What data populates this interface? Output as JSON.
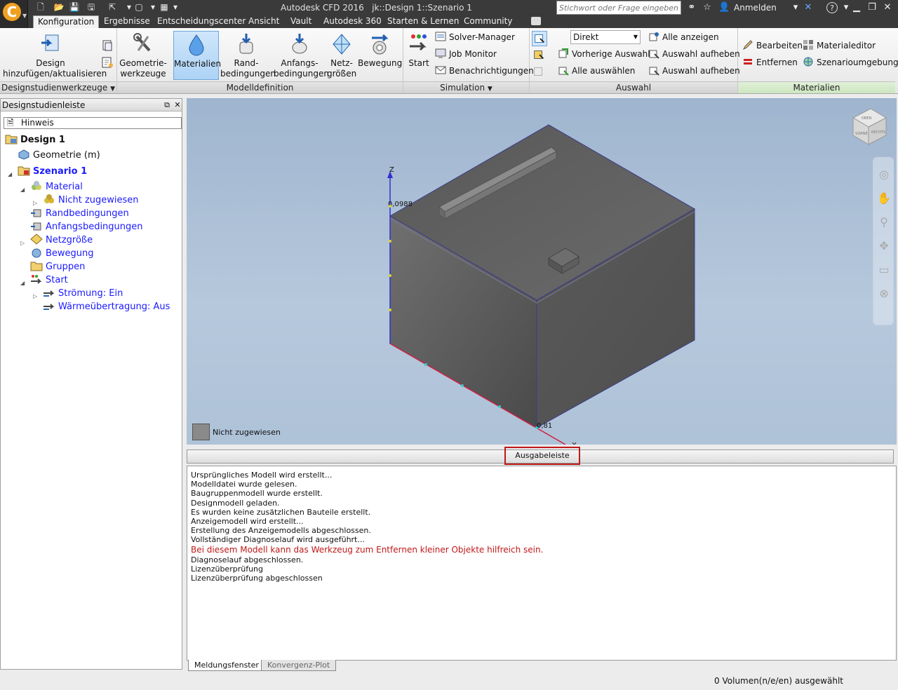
{
  "titlebar": {
    "app_name": "Autodesk CFD 2016",
    "document": "jk::Design 1::Szenario 1",
    "search_placeholder": "Stichwort oder Frage eingeben",
    "signin_label": "Anmelden",
    "help_label": "?"
  },
  "tabs": [
    {
      "label": "Konfiguration"
    },
    {
      "label": "Ergebnisse"
    },
    {
      "label": "Entscheidungscenter"
    },
    {
      "label": "Ansicht"
    },
    {
      "label": "Vault"
    },
    {
      "label": "Autodesk 360"
    },
    {
      "label": "Starten & Lernen"
    },
    {
      "label": "Community"
    }
  ],
  "ribbon": {
    "groups": {
      "designstudien": "Designstudienwerkzeuge",
      "modelldefinition": "Modelldefinition",
      "simulation": "Simulation",
      "auswahl": "Auswahl",
      "materialien": "Materialien"
    },
    "design_add": "Design hinzufügen/aktualisieren",
    "geometry_tools": "Geometrie-\nwerkzeuge",
    "materials": "Materialien",
    "boundary": "Rand-\nbedingungen",
    "initial": "Anfangs-\nbedingungen",
    "mesh": "Netz-\ngrößen",
    "motion": "Bewegung",
    "start": "Start",
    "solver_manager": "Solver-Manager",
    "job_monitor": "Job Monitor",
    "notifications": "Benachrichtigungen",
    "select_mode": "Direkt",
    "previous_selection": "Vorherige Auswahl",
    "select_all": "Alle auswählen",
    "show_all": "Alle anzeigen",
    "deselect1": "Auswahl aufheben",
    "deselect2": "Auswahl aufheben",
    "edit": "Bearbeiten",
    "remove": "Entfernen",
    "material_editor": "Materialeditor",
    "scenario_env": "Szenarioumgebung"
  },
  "leftpanel": {
    "header": "Designstudienleiste",
    "hint": "Hinweis",
    "tree": [
      {
        "label": "Design 1"
      },
      {
        "label": "Geometrie (m)"
      },
      {
        "label": "Szenario 1"
      },
      {
        "label": "Material"
      },
      {
        "label": "Nicht zugewiesen"
      },
      {
        "label": "Randbedingungen"
      },
      {
        "label": "Anfangsbedingungen"
      },
      {
        "label": "Netzgröße"
      },
      {
        "label": "Bewegung"
      },
      {
        "label": "Gruppen"
      },
      {
        "label": "Start"
      },
      {
        "label": "Strömung: Ein"
      },
      {
        "label": "Wärmeübertragung: Aus"
      }
    ]
  },
  "viewport": {
    "axis_z": "Z",
    "axis_x": "X",
    "z_value": "0,0988",
    "x_value": "0,81",
    "legend": "Nicht zugewiesen",
    "viewcube_top": "OBEN",
    "viewcube_front": "VORNE",
    "viewcube_right": "RECHTS"
  },
  "output": {
    "bar_label": "Ausgabeleiste",
    "lines": [
      "Ursprüngliches Modell wird erstellt...",
      "Modelldatei wurde gelesen.",
      "Baugruppenmodell wurde erstellt.",
      "Designmodell geladen.",
      "Es wurden keine zusätzlichen Bauteile erstellt.",
      "Anzeigemodell wird erstellt...",
      "Erstellung des Anzeigemodells abgeschlossen.",
      "Vollständiger Diagnoselauf wird ausgeführt...",
      "Bei diesem Modell kann das Werkzeug zum Entfernen kleiner Objekte hilfreich sein.",
      "Diagnoselauf abgeschlossen.",
      "Lizenzüberprüfung",
      "Lizenzüberprüfung abgeschlossen"
    ],
    "tab_messages": "Meldungsfenster",
    "tab_convergence": "Konvergenz-Plot"
  },
  "status": {
    "text": "0 Volumen(n/e/en) ausgewählt"
  },
  "colors": {
    "accent_orange": "#f0a020",
    "selection_blue": "#aed3f6",
    "warning_red": "#c01818",
    "tree_blue": "#1a1aff",
    "materials_green": "#d8ecd0"
  }
}
